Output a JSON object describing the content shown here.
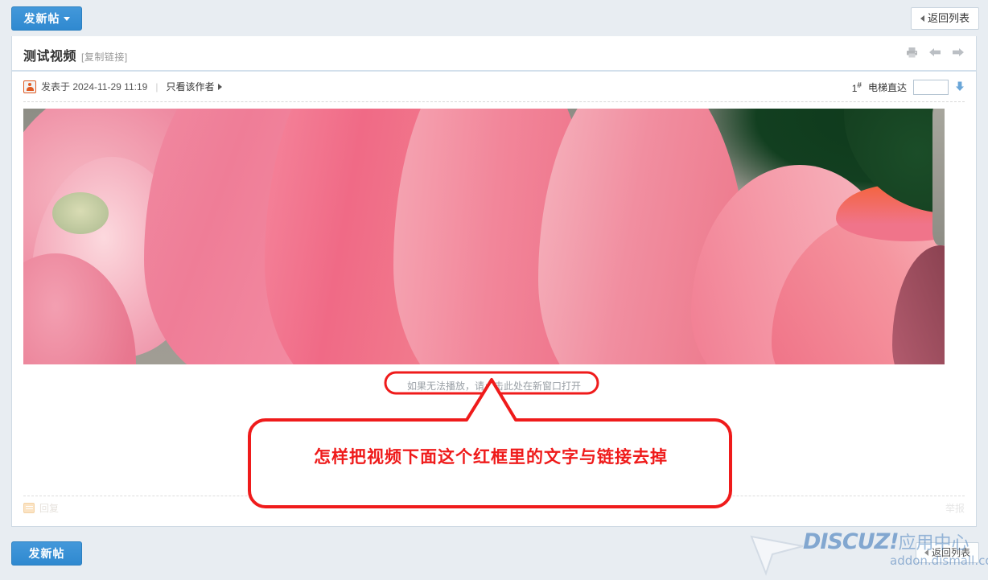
{
  "topbar": {
    "new_thread_label": "发新帖",
    "back_to_list_label": "返回列表"
  },
  "thread": {
    "title": "测试视频",
    "copy_link_label": "[复制链接]",
    "head_icons": [
      "print-icon",
      "arrow-left-icon",
      "arrow-right-icon"
    ],
    "author": {
      "avatar_icon": "user-avatar-icon",
      "posted_on": "发表于 2024-11-29 11:19",
      "separator": "|",
      "only_author_label": "只看该作者"
    },
    "floor": {
      "number": "1",
      "suffix": "#",
      "elevator_label": "电梯直达",
      "elevator_value": "",
      "elevator_placeholder": "",
      "go_icon": "arrow-down-icon"
    },
    "video": {
      "alt": "lotus-flower-video",
      "caption_text": "如果无法播放，请点击此处在新窗口打开"
    },
    "footer": {
      "reply_label": "回复",
      "reply_icon": "reply-icon",
      "report_label": "举报"
    }
  },
  "bottombar": {
    "new_thread_label": "发新帖",
    "back_to_list_label": "返回列表"
  },
  "watermark": {
    "brand": "DISCUZ!",
    "brand_cn": "应用中心",
    "url": "addon.dismall.com",
    "cursor_icon": "cursor-arrow-icon"
  },
  "annotation": {
    "text": "怎样把视频下面这个红框里的文字与链接去掉",
    "color": "#ef1b1b"
  },
  "colors": {
    "accent_blue": "#3a8fd4",
    "page_bg": "#e8edf2",
    "panel_border": "#cfdae4",
    "annotation_red": "#ef1b1b"
  }
}
